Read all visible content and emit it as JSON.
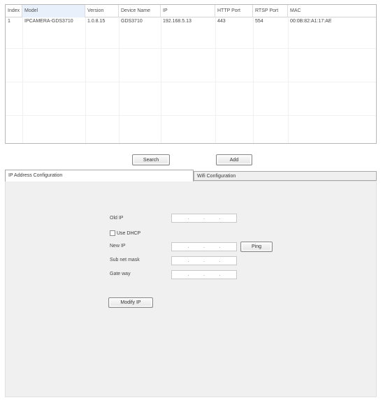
{
  "device_table": {
    "columns": [
      "Index",
      "Model",
      "Version",
      "Device Name",
      "IP",
      "HTTP Port",
      "RTSP Port",
      "MAC"
    ],
    "rows": [
      {
        "index": "1",
        "model": "IPCAMERA-GDS3710",
        "version": "1.0.8.15",
        "device_name": "GDS3710",
        "ip": "192.168.5.13",
        "http_port": "443",
        "rtsp_port": "554",
        "mac": "00:0B:82:A1:17:AE"
      }
    ]
  },
  "actions": {
    "search_label": "Search",
    "add_label": "Add"
  },
  "tabs": {
    "ip_config": "IP Address Configuration",
    "wifi_config": "Wifi Configuration"
  },
  "form": {
    "old_ip_label": "Old IP",
    "use_dhcp_label": "Use DHCP",
    "new_ip_label": "New IP",
    "subnet_label": "Sub net mask",
    "gateway_label": "Gate way",
    "ping_label": "Ping",
    "modify_label": "Modify IP",
    "ip_separator": "."
  },
  "colors": {
    "selected_header": "#e8f0fb",
    "panel_background": "#f0f0f0"
  }
}
